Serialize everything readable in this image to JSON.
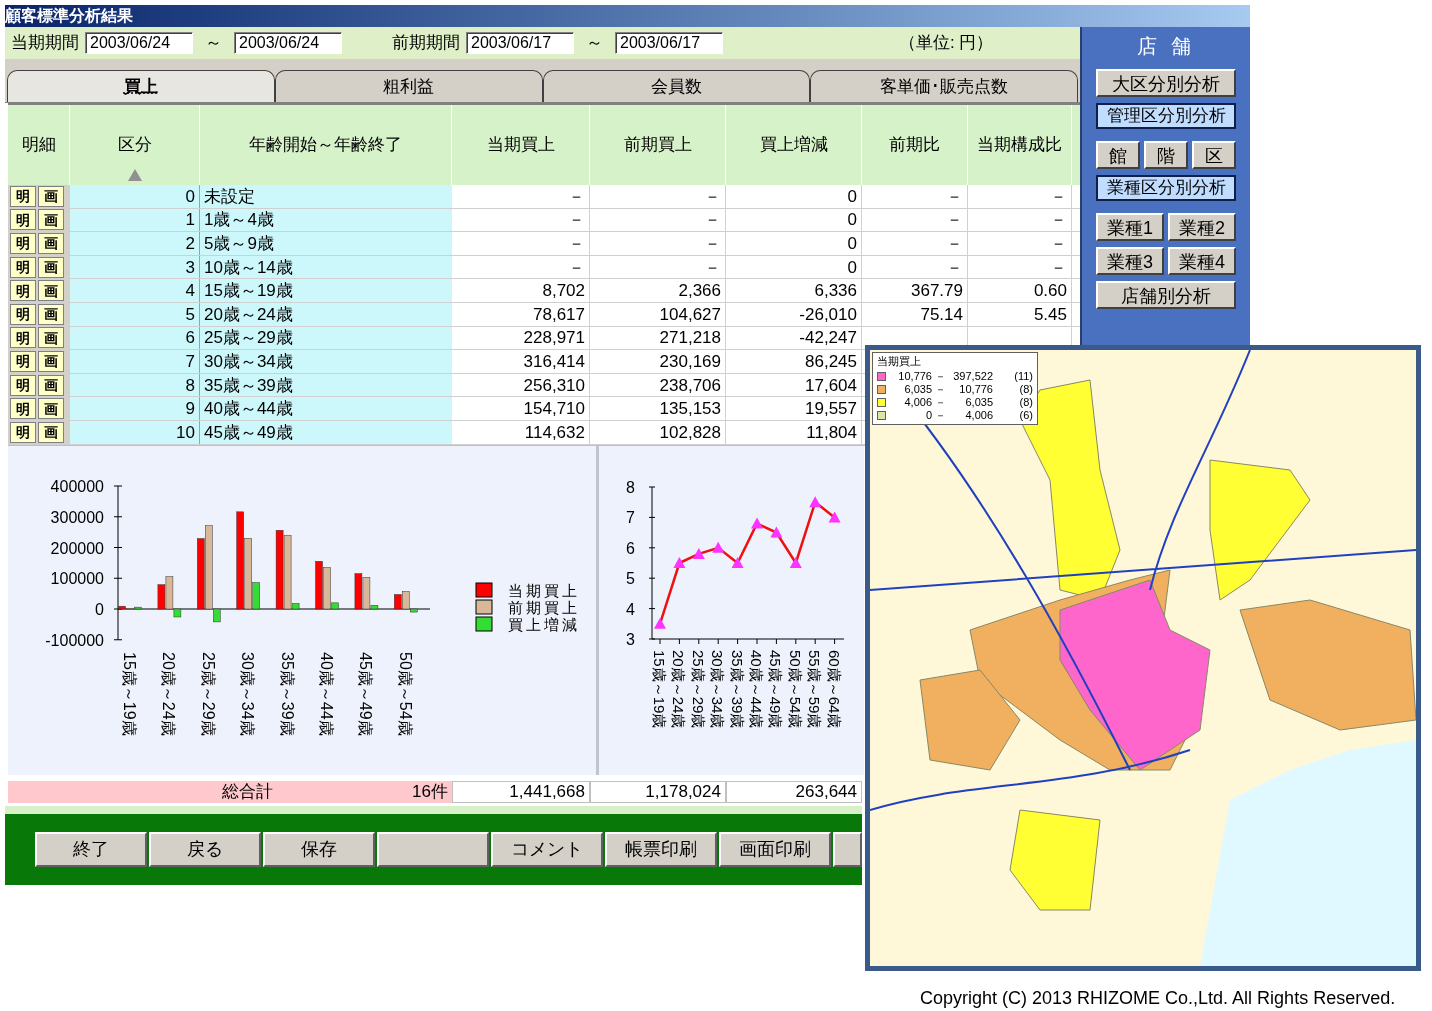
{
  "window": {
    "title": "顧客標準分析結果"
  },
  "period": {
    "current_label": "当期期間",
    "current_from": "2003/06/24",
    "current_sep": "～",
    "current_to": "2003/06/24",
    "previous_label": "前期期間",
    "previous_from": "2003/06/17",
    "previous_sep": "～",
    "previous_to": "2003/06/17",
    "unit": "（単位: 円）"
  },
  "tabs": [
    {
      "label": "買上",
      "selected": true
    },
    {
      "label": "粗利益",
      "selected": false
    },
    {
      "label": "会員数",
      "selected": false
    },
    {
      "label": "客単価･販売点数",
      "selected": false
    }
  ],
  "table": {
    "columns": [
      {
        "label": "明細",
        "sorted": false
      },
      {
        "label": "区分",
        "sorted": true
      },
      {
        "label": "年齢開始～年齢終了",
        "sorted": false
      },
      {
        "label": "当期買上",
        "sorted": false
      },
      {
        "label": "前期買上",
        "sorted": false
      },
      {
        "label": "買上増減",
        "sorted": false
      },
      {
        "label": "前期比",
        "sorted": false
      },
      {
        "label": "当期構成比",
        "sorted": false
      }
    ],
    "rows": [
      {
        "detail": "明",
        "view": "画",
        "code": "0",
        "band": "未設定",
        "current": "－",
        "previous": "－",
        "change": "0",
        "ratio": "－",
        "share": "－"
      },
      {
        "detail": "明",
        "view": "画",
        "code": "1",
        "band": "1歳～4歳",
        "current": "－",
        "previous": "－",
        "change": "0",
        "ratio": "－",
        "share": "－"
      },
      {
        "detail": "明",
        "view": "画",
        "code": "2",
        "band": "5歳～9歳",
        "current": "－",
        "previous": "－",
        "change": "0",
        "ratio": "－",
        "share": "－"
      },
      {
        "detail": "明",
        "view": "画",
        "code": "3",
        "band": "10歳～14歳",
        "current": "－",
        "previous": "－",
        "change": "0",
        "ratio": "－",
        "share": "－"
      },
      {
        "detail": "明",
        "view": "画",
        "code": "4",
        "band": "15歳～19歳",
        "current": "8,702",
        "previous": "2,366",
        "change": "6,336",
        "ratio": "367.79",
        "share": "0.60"
      },
      {
        "detail": "明",
        "view": "画",
        "code": "5",
        "band": "20歳～24歳",
        "current": "78,617",
        "previous": "104,627",
        "change": "-26,010",
        "ratio": "75.14",
        "share": "5.45"
      },
      {
        "detail": "明",
        "view": "画",
        "code": "6",
        "band": "25歳～29歳",
        "current": "228,971",
        "previous": "271,218",
        "change": "-42,247"
      },
      {
        "detail": "明",
        "view": "画",
        "code": "7",
        "band": "30歳～34歳",
        "current": "316,414",
        "previous": "230,169",
        "change": "86,245"
      },
      {
        "detail": "明",
        "view": "画",
        "code": "8",
        "band": "35歳～39歳",
        "current": "256,310",
        "previous": "238,706",
        "change": "17,604"
      },
      {
        "detail": "明",
        "view": "画",
        "code": "9",
        "band": "40歳～44歳",
        "current": "154,710",
        "previous": "135,153",
        "change": "19,557"
      },
      {
        "detail": "明",
        "view": "画",
        "code": "10",
        "band": "45歳～49歳",
        "current": "114,632",
        "previous": "102,828",
        "change": "11,804"
      }
    ]
  },
  "bar_chart": {
    "chart_data": {
      "type": "bar",
      "categories": [
        "15歳～19歳",
        "20歳～24歳",
        "25歳～29歳",
        "30歳～34歳",
        "35歳～39歳",
        "40歳～44歳",
        "45歳～49歳",
        "50歳～54歳"
      ],
      "series": [
        {
          "name": "当期買上",
          "color": "#ff0000",
          "values": [
            9000,
            79000,
            229000,
            316000,
            256000,
            155000,
            115000,
            47000
          ]
        },
        {
          "name": "前期買上",
          "color": "#d8b898",
          "values": [
            2000,
            105000,
            271000,
            230000,
            239000,
            135000,
            103000,
            57000
          ]
        },
        {
          "name": "買上増減",
          "color": "#33dd33",
          "values": [
            6000,
            -26000,
            -42000,
            86000,
            18000,
            20000,
            12000,
            -10000
          ]
        }
      ],
      "ylim": [
        -100000,
        400000
      ],
      "yticks": [
        -100000,
        0,
        100000,
        200000,
        300000,
        400000
      ],
      "legend": "right"
    }
  },
  "line_chart": {
    "chart_data": {
      "type": "line",
      "categories": [
        "15歳～19歳",
        "20歳～24歳",
        "25歳～29歳",
        "30歳～34歳",
        "35歳～39歳",
        "40歳～44歳",
        "45歳～49歳",
        "50歳～54歳",
        "55歳～59歳",
        "60歳～64歳"
      ],
      "series": [
        {
          "color": "#ee1111",
          "marker": "triangle",
          "values": [
            3.5,
            5.5,
            5.8,
            6.0,
            5.5,
            6.8,
            6.5,
            5.5,
            7.5,
            7.0
          ]
        }
      ],
      "ylim": [
        3,
        8
      ],
      "yticks": [
        3,
        4,
        5,
        6,
        7,
        8
      ]
    }
  },
  "total": {
    "label": "総合計",
    "count": "16件",
    "current": "1,441,668",
    "previous": "1,178,024",
    "change": "263,644"
  },
  "side_panel": {
    "title": "店 舗",
    "groups": [
      {
        "kind": "buttons",
        "labels": [
          "大区分別分析"
        ]
      },
      {
        "kind": "heading",
        "labels": [
          "管理区分別分析"
        ]
      },
      {
        "kind": "buttons",
        "labels": [
          "館",
          "階",
          "区"
        ]
      },
      {
        "kind": "heading",
        "labels": [
          "業種区分別分析"
        ]
      },
      {
        "kind": "buttons",
        "labels": [
          "業種1",
          "業種2"
        ]
      },
      {
        "kind": "buttons",
        "labels": [
          "業種3",
          "業種4"
        ]
      },
      {
        "kind": "buttons",
        "labels": [
          "店舗別分析"
        ]
      }
    ]
  },
  "bottom_buttons": [
    {
      "kind": "text",
      "label": "終了"
    },
    {
      "kind": "text",
      "label": "戻る"
    },
    {
      "kind": "text",
      "label": "保存"
    },
    {
      "kind": "blank"
    },
    {
      "kind": "text",
      "label": "コメント"
    },
    {
      "kind": "text",
      "label": "帳票印刷"
    },
    {
      "kind": "text",
      "label": "画面印刷"
    },
    {
      "kind": "blank"
    }
  ],
  "map": {
    "legend": {
      "title": "当期買上",
      "items": [
        {
          "color": "#ff66cc",
          "from": "10,776",
          "sep": "－",
          "to": "397,522",
          "count": "(11)"
        },
        {
          "color": "#f0b060",
          "from": "6,035",
          "sep": "－",
          "to": "10,776",
          "count": "(8)"
        },
        {
          "color": "#ffff33",
          "from": "4,006",
          "sep": "－",
          "to": "6,035",
          "count": "(8)"
        },
        {
          "color": "#dde6a8",
          "from": "0",
          "sep": "－",
          "to": "4,006",
          "count": "(6)"
        }
      ]
    }
  },
  "copyright": "Copyright (C) 2013 RHIZOME Co.,Ltd. All Rights Reserved."
}
